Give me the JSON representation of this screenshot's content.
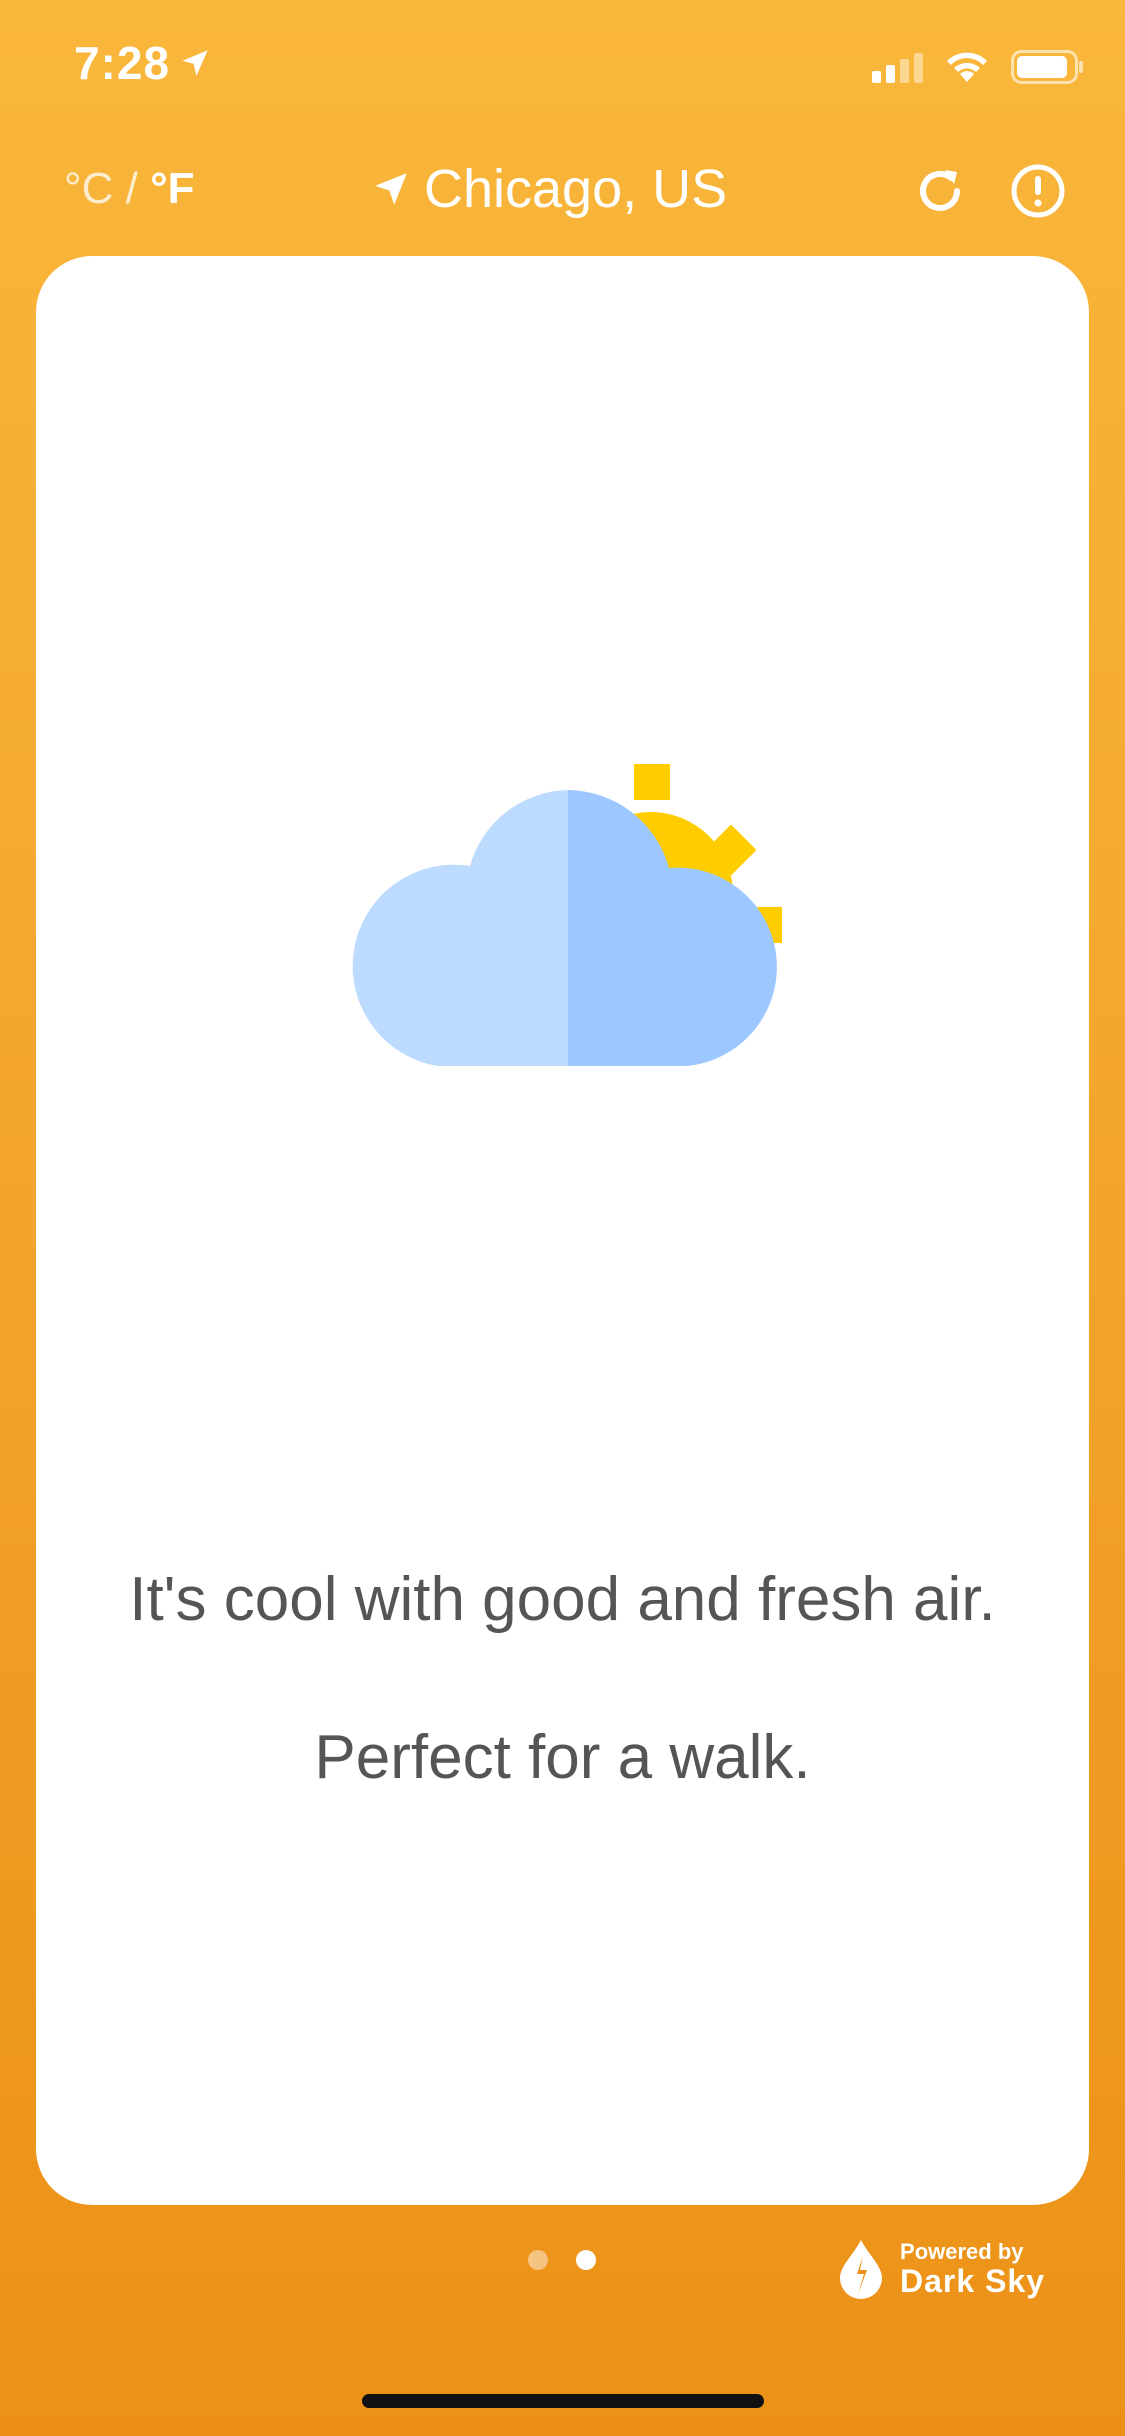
{
  "status_bar": {
    "time": "7:28",
    "location_arrow_icon": "location-arrow-icon",
    "signal_icon": "cellular-signal-icon",
    "wifi_icon": "wifi-icon",
    "battery_icon": "battery-icon"
  },
  "header": {
    "unit_celsius": "°C",
    "unit_separator": " / ",
    "unit_fahrenheit": "°F",
    "location": "Chicago, US",
    "location_icon": "location-arrow-icon",
    "refresh_icon": "refresh-icon",
    "info_icon": "alert-circle-icon"
  },
  "card": {
    "weather_icon": "partly-cloudy-icon",
    "description_line1": "It's cool with good and fresh air.",
    "description_line2": "Perfect for a walk."
  },
  "pager": {
    "pages": 2,
    "active_index": 1
  },
  "footer": {
    "powered_by_small": "Powered by",
    "powered_by_brand": "Dark Sky",
    "brand_icon": "dark-sky-icon"
  },
  "colors": {
    "background_top": "#f9b73b",
    "background_bottom": "#ec9116",
    "cloud_light": "#bddaff",
    "cloud_dark": "#9dc8ff",
    "sun": "#ffcc00",
    "text_description": "#555555"
  }
}
